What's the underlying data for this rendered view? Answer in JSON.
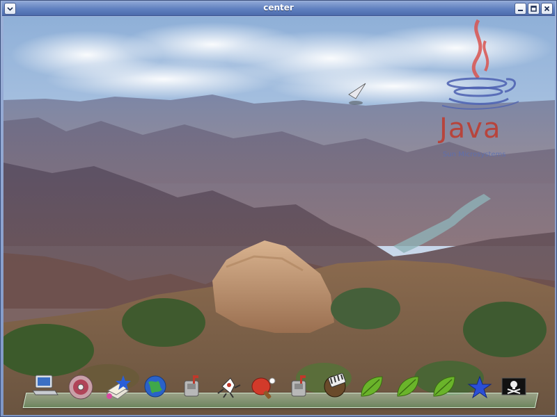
{
  "window": {
    "title": "center",
    "controls": {
      "menu_icon": "chevron-down-icon",
      "minimize_icon": "minimize-icon",
      "maximize_icon": "maximize-icon",
      "close_icon": "close-icon"
    }
  },
  "background": {
    "description_icon": "canyon-wallpaper"
  },
  "logo": {
    "brand": "Java",
    "subtitle": "Sun Microsystems",
    "brand_color": "#c0392b"
  },
  "dock": {
    "items": [
      {
        "icon": "laptop-icon"
      },
      {
        "icon": "cd-drive-icon"
      },
      {
        "icon": "bookmarks-star-icon"
      },
      {
        "icon": "globe-icon"
      },
      {
        "icon": "mailbox-icon"
      },
      {
        "icon": "duke-mascot-icon"
      },
      {
        "icon": "ping-pong-icon"
      },
      {
        "icon": "mailbox-icon"
      },
      {
        "icon": "film-reel-icon"
      },
      {
        "icon": "leaf-icon"
      },
      {
        "icon": "leaf-icon"
      },
      {
        "icon": "leaf-icon"
      },
      {
        "icon": "star-icon"
      },
      {
        "icon": "pirate-flag-icon"
      }
    ]
  }
}
